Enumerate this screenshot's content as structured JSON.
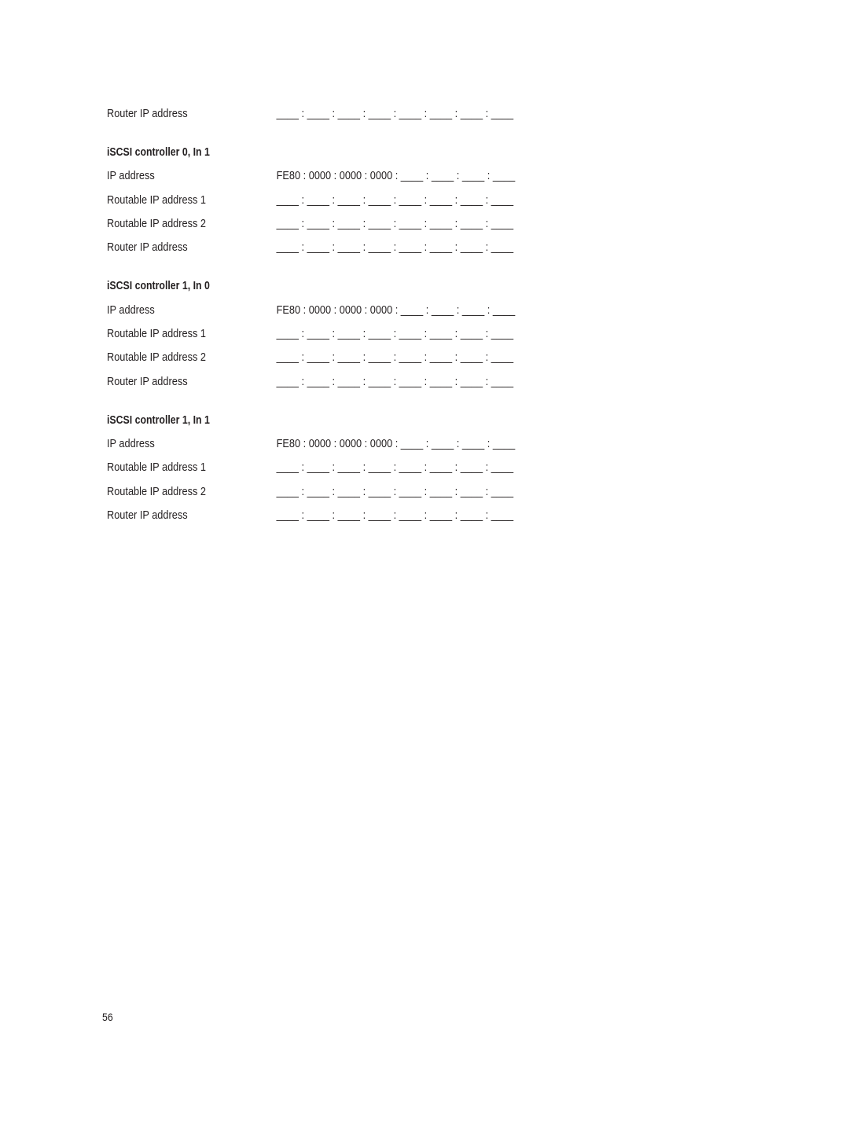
{
  "blank_ip": "____ : ____ : ____ : ____ : ____ : ____ : ____ : ____",
  "linklocal_ip": "FE80 : 0000 : 0000 : 0000 : ____ : ____ : ____ : ____",
  "top_row": {
    "label": "Router IP address",
    "value": "____ : ____ : ____ : ____ : ____ : ____ : ____ : ____"
  },
  "sections": [
    {
      "heading": "iSCSI controller 0, In 1",
      "rows": [
        {
          "label": "IP address",
          "value": "FE80 : 0000 : 0000 : 0000 : ____ : ____ : ____ : ____"
        },
        {
          "label": "Routable IP address 1",
          "value": "____ : ____ : ____ : ____ : ____ : ____ : ____ : ____"
        },
        {
          "label": "Routable IP address 2",
          "value": "____ : ____ : ____ : ____ : ____ : ____ : ____ : ____"
        },
        {
          "label": "Router IP address",
          "value": "____ : ____ : ____ : ____ : ____ : ____ : ____ : ____"
        }
      ]
    },
    {
      "heading": "iSCSI controller 1, In 0",
      "rows": [
        {
          "label": "IP address",
          "value": "FE80 : 0000 : 0000 : 0000 : ____ : ____ : ____ : ____"
        },
        {
          "label": "Routable IP address 1",
          "value": "____ : ____ : ____ : ____ : ____ : ____ : ____ : ____"
        },
        {
          "label": "Routable IP address 2",
          "value": "____ : ____ : ____ : ____ : ____ : ____ : ____ : ____"
        },
        {
          "label": "Router IP address",
          "value": "____ : ____ : ____ : ____ : ____ : ____ : ____ : ____"
        }
      ]
    },
    {
      "heading": "iSCSI controller 1, In 1",
      "rows": [
        {
          "label": "IP address",
          "value": "FE80 : 0000 : 0000 : 0000 : ____ : ____ : ____ : ____"
        },
        {
          "label": "Routable IP address 1",
          "value": "____ : ____ : ____ : ____ : ____ : ____ : ____ : ____"
        },
        {
          "label": "Routable IP address 2",
          "value": "____ : ____ : ____ : ____ : ____ : ____ : ____ : ____"
        },
        {
          "label": "Router IP address",
          "value": "____ : ____ : ____ : ____ : ____ : ____ : ____ : ____"
        }
      ]
    }
  ],
  "page_number": "56"
}
